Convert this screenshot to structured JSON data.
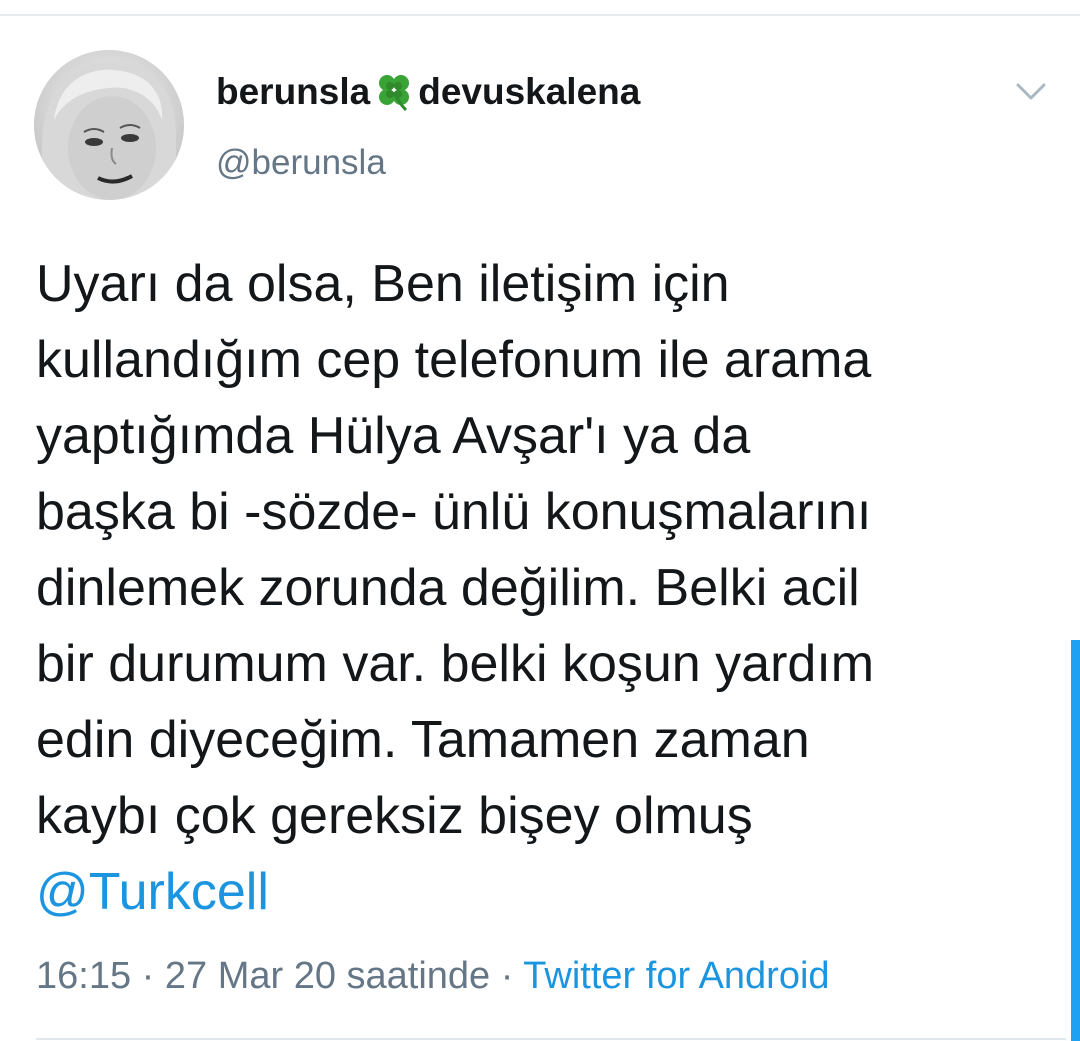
{
  "user": {
    "name_part1": "berunsla",
    "name_emoji_icon": "four-leaf-clover-icon",
    "name_part2": "devuskalena",
    "handle": "@berunsla"
  },
  "tweet": {
    "lines": [
      "Uyarı da olsa, Ben iletişim için",
      "kullandığım cep telefonum ile arama",
      "yaptığımda Hülya Avşar'ı ya da",
      "başka bi -sözde- ünlü konuşmalarını",
      "dinlemek zorunda değilim. Belki acil",
      "bir durumum var. belki koşun yardım",
      "edin diyeceğim. Tamamen zaman",
      "kaybı çok gereksiz bişey olmuş"
    ],
    "mention": "@Turkcell"
  },
  "meta": {
    "time": "16:15",
    "separator": "·",
    "date": "27 Mar 20 saatinde",
    "source": "Twitter for Android"
  },
  "colors": {
    "text": "#14171a",
    "secondary": "#657786",
    "link": "#1b95e0",
    "accent": "#1da1f2"
  }
}
